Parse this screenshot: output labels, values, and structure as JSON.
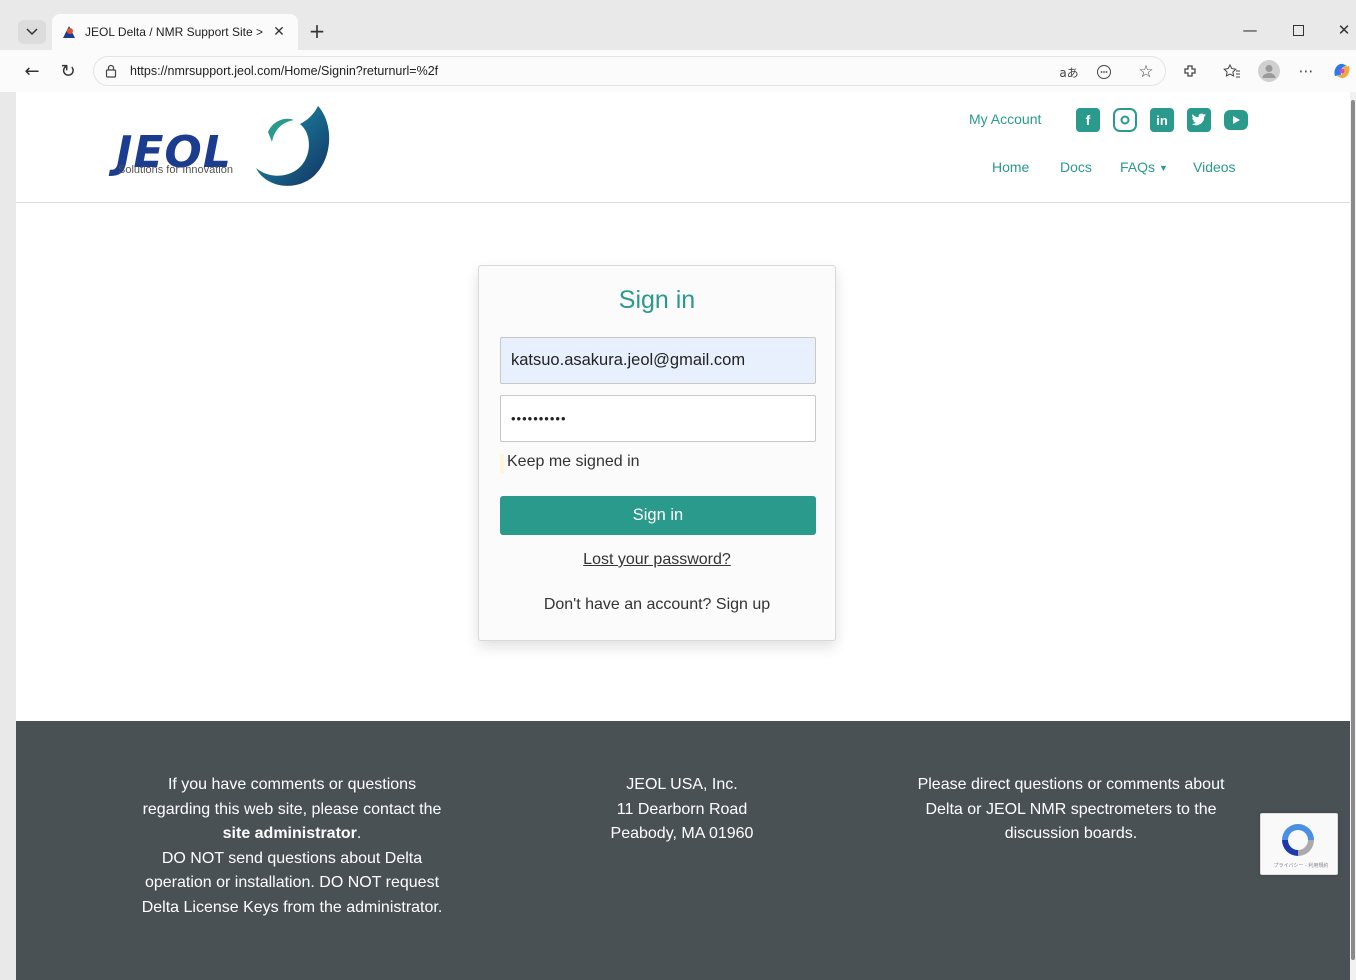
{
  "browser": {
    "tab_title": "JEOL Delta / NMR Support Site >",
    "url": "https://nmrsupport.jeol.com/Home/Signin?returnurl=%2f",
    "translate_label": "aあ"
  },
  "header": {
    "logo_text": "JEOL",
    "logo_tagline": "Solutions for Innovation",
    "my_account": "My Account",
    "social": [
      "facebook-icon",
      "instagram-icon",
      "linkedin-icon",
      "twitter-icon",
      "youtube-icon"
    ],
    "nav": [
      {
        "label": "Home"
      },
      {
        "label": "Docs"
      },
      {
        "label": "FAQs"
      },
      {
        "label": "Videos"
      }
    ]
  },
  "signin": {
    "title": "Sign in",
    "email_value": "katsuo.asakura.jeol@gmail.com",
    "password_value": "••••••••••",
    "keep_signed_in": "Keep me signed in",
    "button": "Sign in",
    "lost_password": "Lost your password?",
    "signup": "Don't have an account? Sign up"
  },
  "footer": {
    "col1_line1": "If you have comments or questions",
    "col1_line2": "regarding this web site, please contact the",
    "col1_link": "site administrator",
    "col1_link_suffix": ".",
    "col1_line4": "DO NOT send questions about Delta",
    "col1_line5": "operation or installation. DO NOT request",
    "col1_line6": "Delta License Keys from the administrator.",
    "col2_line1": "JEOL USA, Inc.",
    "col2_line2": "11 Dearborn Road",
    "col2_line3": "Peabody, MA 01960",
    "col3_line1": "Please direct questions or comments about",
    "col3_line2": "Delta or JEOL NMR spectrometers to the",
    "col3_line3": "discussion boards."
  },
  "recaptcha": {
    "text": "プライバシー - 利用規約"
  },
  "colors": {
    "accent": "#2a9a8c",
    "brand_blue": "#1c3d8f",
    "footer_bg": "#4a5155"
  }
}
